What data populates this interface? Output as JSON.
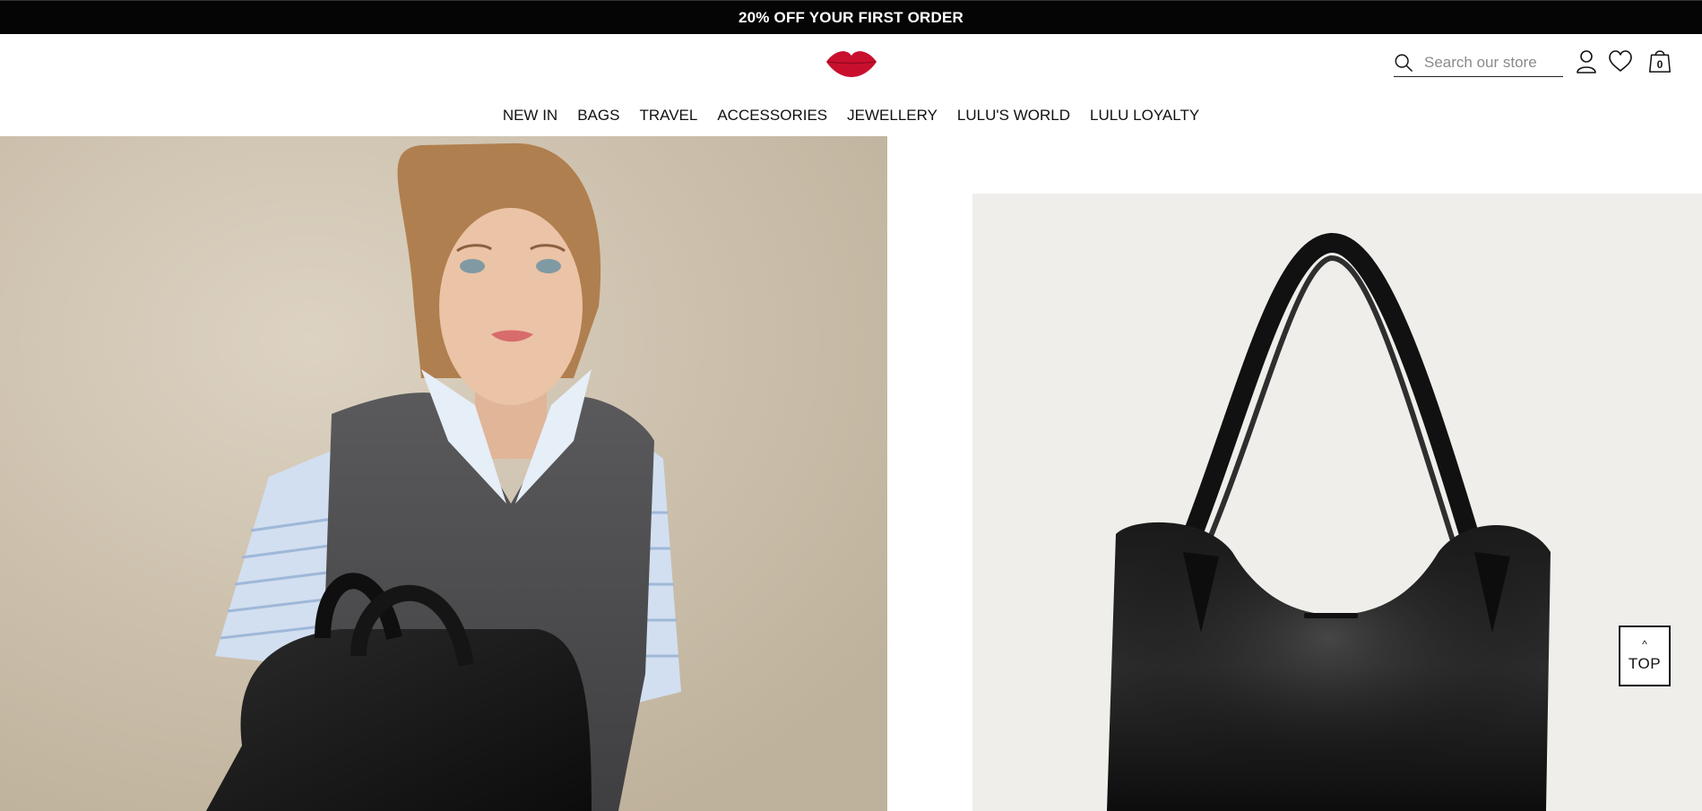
{
  "promo": {
    "text": "20% OFF YOUR FIRST ORDER"
  },
  "brand": {
    "logo": "lips-logo",
    "color": "#c8102e"
  },
  "search": {
    "placeholder": "Search our store",
    "value": ""
  },
  "header_icons": {
    "account": "account-icon",
    "wishlist": "heart-icon",
    "bag": "shopping-bag-icon",
    "bag_count": "0"
  },
  "nav": {
    "items": [
      {
        "label": "NEW IN"
      },
      {
        "label": "BAGS"
      },
      {
        "label": "TRAVEL"
      },
      {
        "label": "ACCESSORIES"
      },
      {
        "label": "JEWELLERY"
      },
      {
        "label": "LULU'S WORLD"
      },
      {
        "label": "LULU LOYALTY"
      }
    ]
  },
  "hero": {
    "left_image": "model-with-black-tote-bag",
    "right_image": "black-leather-tote-bag"
  },
  "scroll_top": {
    "arrow": "^",
    "label": "TOP"
  },
  "colors": {
    "promo_bg": "#050505",
    "text": "#111111",
    "accent": "#c8102e"
  }
}
